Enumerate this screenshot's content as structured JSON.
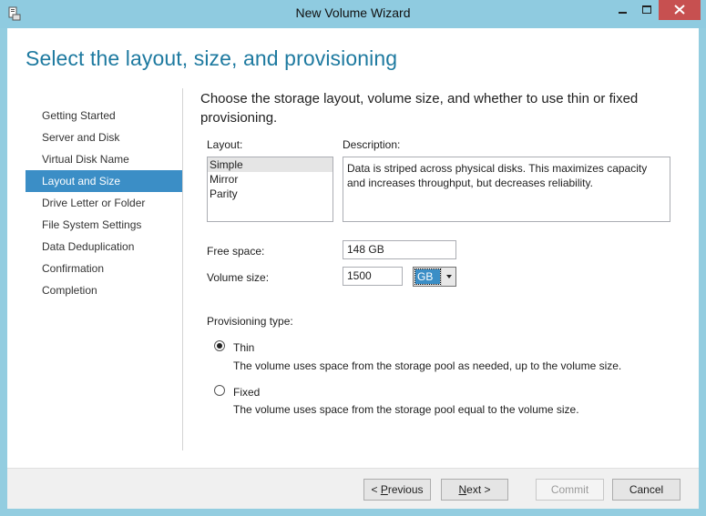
{
  "window": {
    "title": "New Volume Wizard"
  },
  "page": {
    "title": "Select the layout, size, and provisioning",
    "instructions": "Choose the storage layout, volume size, and whether to use thin or fixed provisioning."
  },
  "nav": {
    "items": [
      {
        "label": "Getting Started",
        "active": false
      },
      {
        "label": "Server and Disk",
        "active": false
      },
      {
        "label": "Virtual Disk Name",
        "active": false
      },
      {
        "label": "Layout and Size",
        "active": true
      },
      {
        "label": "Drive Letter or Folder",
        "active": false
      },
      {
        "label": "File System Settings",
        "active": false
      },
      {
        "label": "Data Deduplication",
        "active": false
      },
      {
        "label": "Confirmation",
        "active": false
      },
      {
        "label": "Completion",
        "active": false
      }
    ]
  },
  "layout": {
    "label": "Layout:",
    "options": [
      "Simple",
      "Mirror",
      "Parity"
    ],
    "selected": "Simple"
  },
  "description": {
    "label": "Description:",
    "text": "Data is striped across physical disks. This maximizes capacity and increases throughput, but decreases reliability."
  },
  "free_space": {
    "label": "Free space:",
    "value": "148 GB"
  },
  "volume_size": {
    "label": "Volume size:",
    "value": "1500",
    "unit": "GB"
  },
  "provisioning": {
    "label": "Provisioning type:",
    "thin": {
      "label": "Thin",
      "description": "The volume uses space from the storage pool as needed, up to the volume size.",
      "checked": true
    },
    "fixed": {
      "label": "Fixed",
      "description": "The volume uses space from the storage pool equal to the volume size.",
      "checked": false
    }
  },
  "buttons": {
    "previous_mnemonic": "P",
    "previous_rest": "revious",
    "next_mnemonic": "N",
    "next_rest": "ext >",
    "commit": "Commit",
    "cancel": "Cancel"
  },
  "colors": {
    "accent": "#3b8ec6",
    "title_text": "#1e7aa0",
    "frame": "#8fcbe0",
    "close": "#c75050"
  }
}
